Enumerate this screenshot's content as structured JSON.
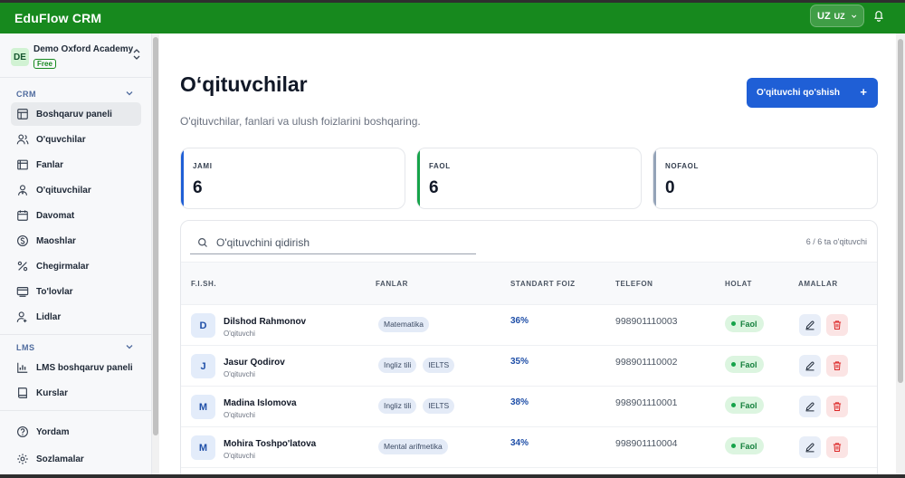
{
  "app": {
    "title": "EduFlow CRM"
  },
  "header": {
    "lang_code": "UZ",
    "lang_label": "UZ"
  },
  "org": {
    "initials": "DE",
    "name": "Demo Oxford Academy",
    "plan": "Free"
  },
  "sidebar": {
    "crm_label": "CRM",
    "crm_items": [
      {
        "label": "Boshqaruv paneli",
        "icon": "dashboard-icon"
      },
      {
        "label": "O'quvchilar",
        "icon": "users-icon"
      },
      {
        "label": "Fanlar",
        "icon": "book-icon"
      },
      {
        "label": "O'qituvchilar",
        "icon": "teacher-icon"
      },
      {
        "label": "Davomat",
        "icon": "calendar-icon"
      },
      {
        "label": "Maoshlar",
        "icon": "dollar-icon"
      },
      {
        "label": "Chegirmalar",
        "icon": "percent-icon"
      },
      {
        "label": "To'lovlar",
        "icon": "payment-icon"
      },
      {
        "label": "Lidlar",
        "icon": "leads-icon"
      }
    ],
    "lms_label": "LMS",
    "lms_items": [
      {
        "label": "LMS boshqaruv paneli",
        "icon": "chart-icon"
      },
      {
        "label": "Kurslar",
        "icon": "courses-icon"
      }
    ],
    "footer_items": [
      {
        "label": "Yordam",
        "icon": "help-icon"
      },
      {
        "label": "Sozlamalar",
        "icon": "settings-icon"
      }
    ]
  },
  "page": {
    "title": "O‘qituvchilar",
    "subtitle": "O'qituvchilar, fanlari va ulush foizlarini boshqaring.",
    "add_button": "O'qituvchi qo'shish"
  },
  "stats": [
    {
      "label": "JAMI",
      "value": "6",
      "color": "#1f5fd6"
    },
    {
      "label": "FAOL",
      "value": "6",
      "color": "#16a34a"
    },
    {
      "label": "NOFAOL",
      "value": "0",
      "color": "#94a3b8"
    }
  ],
  "table": {
    "search_placeholder": "O'qituvchini qidirish",
    "count_text": "6 / 6 ta o'qituvchi",
    "headers": [
      "F.I.SH.",
      "FANLAR",
      "STANDART FOIZ",
      "TELEFON",
      "HOLAT",
      "AMALLAR"
    ],
    "rows": [
      {
        "initial": "D",
        "name": "Dilshod Rahmonov",
        "role": "O'qituvchi",
        "subjects": [
          "Matematika"
        ],
        "percent": "36%",
        "phone": "998901110003",
        "status": "Faol"
      },
      {
        "initial": "J",
        "name": "Jasur Qodirov",
        "role": "O'qituvchi",
        "subjects": [
          "Ingliz tili",
          "IELTS"
        ],
        "percent": "35%",
        "phone": "998901110002",
        "status": "Faol"
      },
      {
        "initial": "M",
        "name": "Madina Islomova",
        "role": "O'qituvchi",
        "subjects": [
          "Ingliz tili",
          "IELTS"
        ],
        "percent": "38%",
        "phone": "998901110001",
        "status": "Faol"
      },
      {
        "initial": "M",
        "name": "Mohira Toshpo'latova",
        "role": "O'qituvchi",
        "subjects": [
          "Mental arifmetika"
        ],
        "percent": "34%",
        "phone": "998901110004",
        "status": "Faol"
      }
    ]
  }
}
